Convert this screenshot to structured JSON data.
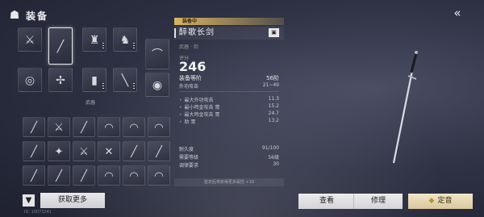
{
  "header": {
    "title": "装备",
    "logo_icon": "character-icon",
    "back_icon": "back-arrow-icon"
  },
  "equipped": {
    "label": "武器",
    "slots": [
      {
        "icon": "sword-icon",
        "glyph": "⚔",
        "selected": false
      },
      {
        "icon": "sword-icon",
        "glyph": "╱",
        "selected": true
      },
      {
        "icon": "armor-icon",
        "glyph": "♜",
        "selected": false
      },
      {
        "icon": "armor-icon",
        "glyph": "♞",
        "selected": false
      },
      {
        "icon": "bow-icon",
        "glyph": "⌒",
        "selected": false
      },
      {
        "icon": "ring-icon",
        "glyph": "◎",
        "selected": false
      },
      {
        "icon": "hidden-weapon-icon",
        "glyph": "✢",
        "selected": false
      },
      {
        "icon": "bracer-icon",
        "glyph": "▮",
        "selected": false
      },
      {
        "icon": "dagger-icon",
        "glyph": "╲",
        "selected": false
      },
      {
        "icon": "ring-icon",
        "glyph": "◉",
        "selected": false
      }
    ]
  },
  "inventory": {
    "items": [
      {
        "icon": "spear-icon",
        "glyph": "╱"
      },
      {
        "icon": "sword-icon",
        "glyph": "⚔"
      },
      {
        "icon": "sword-icon",
        "glyph": "╱"
      },
      {
        "icon": "fan-icon",
        "glyph": "◠"
      },
      {
        "icon": "fan-icon",
        "glyph": "◠"
      },
      {
        "icon": "fan-icon",
        "glyph": "◠"
      },
      {
        "icon": "spear-icon",
        "glyph": "╱"
      },
      {
        "icon": "halberd-icon",
        "glyph": "✦"
      },
      {
        "icon": "sword-icon",
        "glyph": "⚔"
      },
      {
        "icon": "sword-icon",
        "glyph": "✕"
      },
      {
        "icon": "sword-icon",
        "glyph": "╱"
      },
      {
        "icon": "sword-icon",
        "glyph": "╱"
      },
      {
        "icon": "spear-icon",
        "glyph": "╱"
      },
      {
        "icon": "sword-icon",
        "glyph": "╱"
      },
      {
        "icon": "sword-icon",
        "glyph": "╱"
      },
      {
        "icon": "fan-icon",
        "glyph": "◠"
      },
      {
        "icon": "fan-icon",
        "glyph": "◠"
      },
      {
        "icon": "fan-icon",
        "glyph": "◠"
      }
    ]
  },
  "filter": {
    "icon": "filter-icon"
  },
  "get_more_label": "获取更多",
  "watermark": "ID: 10073241",
  "detail": {
    "equipped_tag": "装备中",
    "name": "醉歌长剑",
    "lock_icon": "lock-icon",
    "subtype": "武器 · 剑",
    "score_label": "评分",
    "score": "246",
    "rows_major": [
      {
        "label": "装备等阶",
        "value": "56阶"
      },
      {
        "label": "外功攻击",
        "value": "21~49"
      }
    ],
    "rows_bonus": [
      {
        "bullet": "•",
        "label": "最大外功攻击",
        "value": "11.3"
      },
      {
        "bullet": "•",
        "label": "最小鸣金攻击 胃",
        "value": "15.2"
      },
      {
        "bullet": "•",
        "label": "最大鸣金攻击 胃",
        "value": "24.7"
      },
      {
        "bullet": "•",
        "label": "助 胃",
        "value": "13.2"
      }
    ],
    "rows_footer": [
      {
        "label": "耐久度",
        "value": "91/100"
      },
      {
        "label": "需要等级",
        "value": "56级"
      },
      {
        "label": "调律要求",
        "value": "30"
      }
    ],
    "hint": "鉴定后将获得更多属性 +10"
  },
  "buttons": {
    "compare": "查看",
    "repair": "修理",
    "forge": "定音",
    "forge_icon": "diamond-icon"
  },
  "colors": {
    "gold_tag": "#d8b463",
    "background": "#2f3244"
  }
}
